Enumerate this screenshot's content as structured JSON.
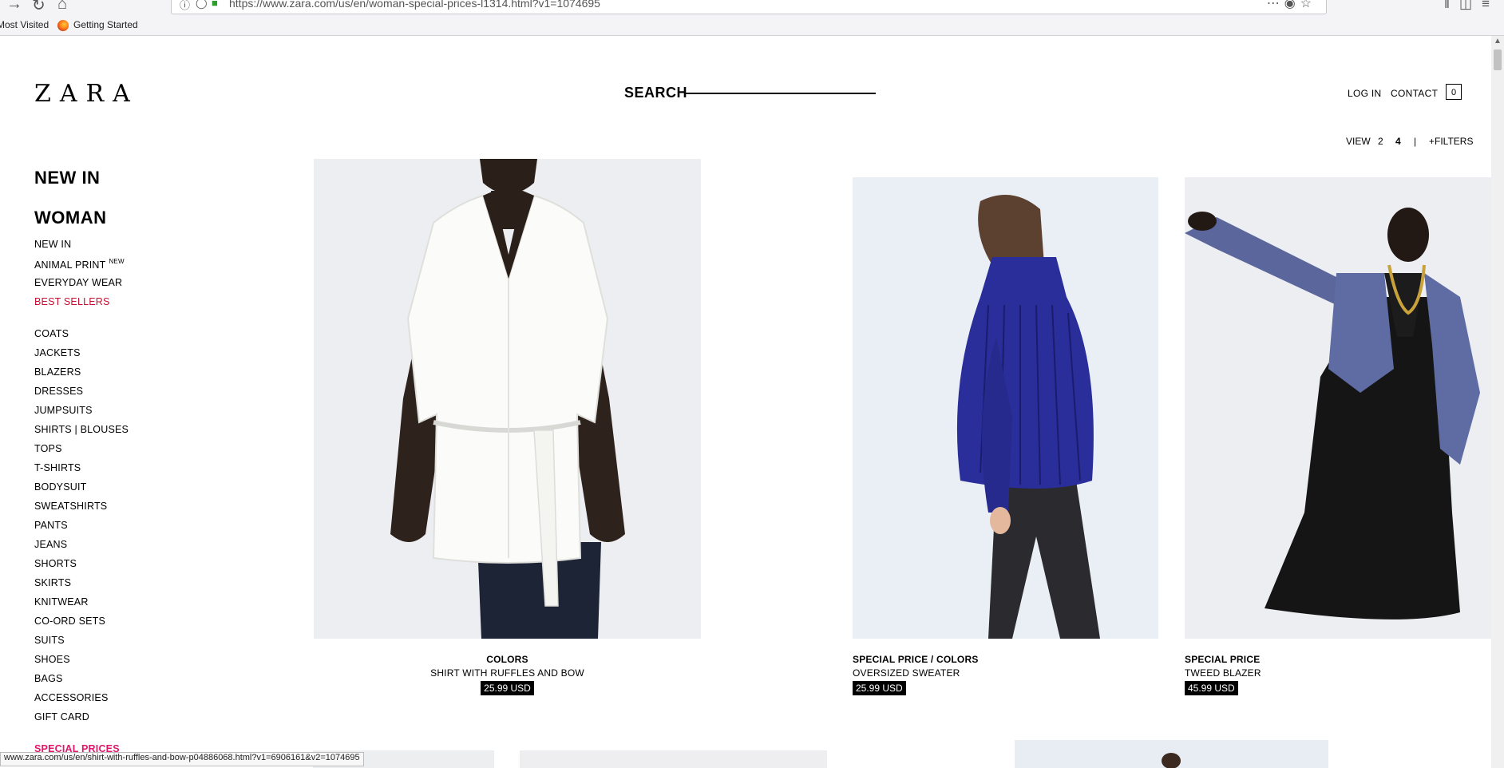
{
  "browser": {
    "url": "https://www.zara.com/us/en/woman-special-prices-l1314.html?v1=1074695",
    "bookmarks": [
      "Most Visited",
      "Getting Started"
    ],
    "status_url": "www.zara.com/us/en/shirt-with-ruffles-and-bow-p04886068.html?v1=6906161&v2=1074695"
  },
  "header": {
    "logo": "ZARA",
    "search_label": "SEARCH",
    "login": "LOG IN",
    "contact": "CONTACT",
    "cart_count": "0"
  },
  "view_bar": {
    "view_label": "VIEW",
    "option_2": "2",
    "option_4": "4",
    "separator": "|",
    "filters": "+FILTERS"
  },
  "menu": {
    "new_in_heading": "NEW IN",
    "woman_heading": "WOMAN",
    "items": [
      {
        "label": "NEW IN"
      },
      {
        "label": "ANIMAL PRINT",
        "badge": "NEW"
      },
      {
        "label": "EVERYDAY WEAR"
      },
      {
        "label": "BEST SELLERS"
      },
      {
        "label": "COATS"
      },
      {
        "label": "JACKETS"
      },
      {
        "label": "BLAZERS"
      },
      {
        "label": "DRESSES"
      },
      {
        "label": "JUMPSUITS"
      },
      {
        "label": "SHIRTS | BLOUSES"
      },
      {
        "label": "TOPS"
      },
      {
        "label": "T-SHIRTS"
      },
      {
        "label": "BODYSUIT"
      },
      {
        "label": "SWEATSHIRTS"
      },
      {
        "label": "PANTS"
      },
      {
        "label": "JEANS"
      },
      {
        "label": "SHORTS"
      },
      {
        "label": "SKIRTS"
      },
      {
        "label": "KNITWEAR"
      },
      {
        "label": "CO-ORD SETS"
      },
      {
        "label": "SUITS"
      },
      {
        "label": "SHOES"
      },
      {
        "label": "BAGS"
      },
      {
        "label": "ACCESSORIES"
      },
      {
        "label": "GIFT CARD"
      },
      {
        "label": "SPECIAL PRICES"
      }
    ]
  },
  "products": [
    {
      "tag": "COLORS",
      "name": "SHIRT WITH RUFFLES AND BOW",
      "price": "25.99 USD"
    },
    {
      "tag": "SPECIAL PRICE / COLORS",
      "name": "OVERSIZED SWEATER",
      "price": "25.99 USD"
    },
    {
      "tag": "SPECIAL PRICE",
      "name": "TWEED BLAZER",
      "price": "45.99 USD"
    }
  ],
  "colors": {
    "best_sellers": "#c8102e",
    "special_prices": "#e2176b",
    "price_bg": "#000000"
  }
}
